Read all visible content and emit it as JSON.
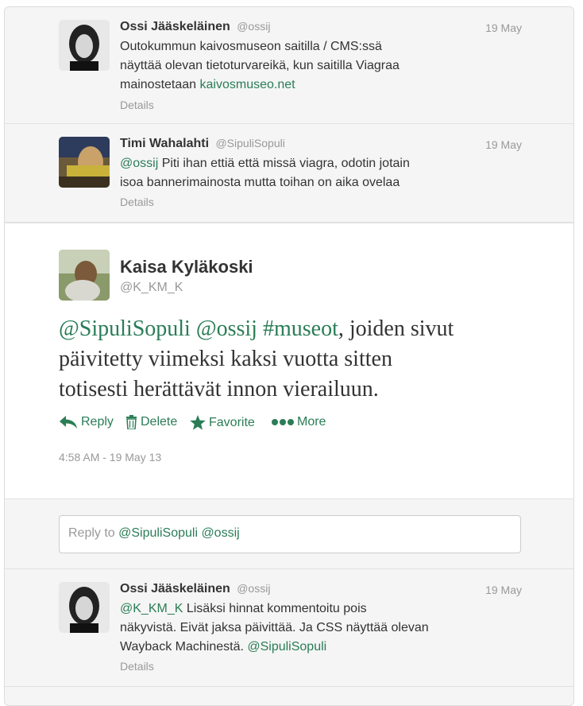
{
  "tweets_before": [
    {
      "name": "Ossi Jääskeläinen",
      "handle": "@ossij",
      "time": "19 May",
      "text_lines": [
        "Outokummun kaivosmuseon saitilla / CMS:ssä",
        "näyttää olevan tietoturvareikä, kun saitilla Viagraa",
        "mainostetaan "
      ],
      "link": "kaivosmuseo.net",
      "details": "Details"
    },
    {
      "name": "Timi Wahalahti",
      "handle": "@SipuliSopuli",
      "time": "19 May",
      "mention": "@ossij",
      "text_lines": [
        " Piti ihan ettiä että missä viagra, odotin jotain",
        "isoa bannerimainosta mutta toihan on aika ovelaa"
      ],
      "details": "Details"
    }
  ],
  "main_tweet": {
    "name": "Kaisa Kyläkoski",
    "handle": "@K_KM_K",
    "mention1": "@SipuliSopuli",
    "mention2": "@ossij",
    "hashtag": "#museot",
    "text_rest": ", joiden sivut",
    "line2": "päivitetty viimeksi kaksi vuotta sitten",
    "line3": "totisesti herättävät innon vierailuun.",
    "actions": {
      "reply": "Reply",
      "delete": "Delete",
      "favorite": "Favorite",
      "more": "More"
    },
    "timestamp": "4:58 AM - 19 May 13"
  },
  "reply_box": {
    "prefix": "Reply to ",
    "mentions": "@SipuliSopuli @ossij"
  },
  "tweets_after": [
    {
      "name": "Ossi Jääskeläinen",
      "handle": "@ossij",
      "time": "19 May",
      "mention": "@K_KM_K",
      "text_lines": [
        " Lisäksi hinnat kommentoitu pois",
        "näkyvistä. Eivät jaksa päivittää. Ja CSS näyttää olevan",
        "Wayback Machinestä. "
      ],
      "mention_end": "@SipuliSopuli",
      "details": "Details"
    }
  ],
  "colors": {
    "link": "#2a7d56",
    "muted": "#999999",
    "text": "#333333",
    "background": "#f5f5f5"
  },
  "icons": [
    "reply-icon",
    "trash-icon",
    "star-icon",
    "more-dots-icon"
  ]
}
